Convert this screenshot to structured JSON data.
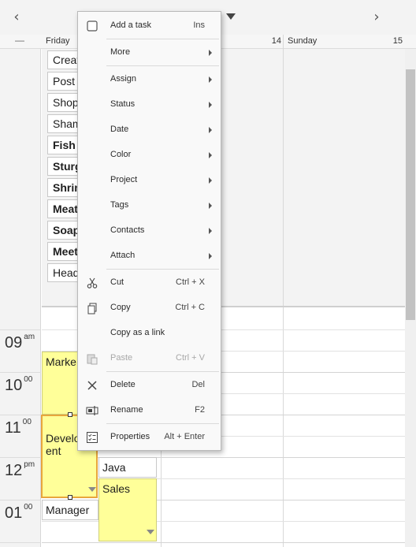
{
  "nav": {
    "prev_icon": "chevron-left-icon",
    "next_icon": "chevron-right-icon",
    "prev_glyph": "‹",
    "next_glyph": "›",
    "dropdown_icon": "caret-down-icon",
    "collapse_glyph": "—"
  },
  "days": [
    {
      "name": "Friday",
      "number": ""
    },
    {
      "name": "",
      "number": "14"
    },
    {
      "name": "Sunday",
      "number": "15"
    }
  ],
  "hours": [
    {
      "hour": "09",
      "suffix": "am"
    },
    {
      "hour": "10",
      "suffix": "00"
    },
    {
      "hour": "11",
      "suffix": "00"
    },
    {
      "hour": "12",
      "suffix": "pm"
    },
    {
      "hour": "01",
      "suffix": "00"
    }
  ],
  "tasks": [
    {
      "label": "Creat",
      "bold": false
    },
    {
      "label": "Post",
      "bold": false
    },
    {
      "label": "Shop",
      "bold": false
    },
    {
      "label": "Sham",
      "bold": false
    },
    {
      "label": "Fish",
      "bold": true
    },
    {
      "label": "Sturg",
      "bold": true
    },
    {
      "label": "Shrin",
      "bold": true
    },
    {
      "label": "Meat",
      "bold": true
    },
    {
      "label": "Soap",
      "bold": true
    },
    {
      "label": "Meet",
      "bold": true
    },
    {
      "label": "Head",
      "bold": false
    }
  ],
  "events": {
    "marketing": "Marke",
    "development": "Develo\nent",
    "java": "Java",
    "sales": "Sales",
    "manager": "Manager"
  },
  "context_menu": {
    "add_task": {
      "label": "Add a task",
      "shortcut": "Ins",
      "icon": "checkbox-icon"
    },
    "more": {
      "label": "More"
    },
    "assign": {
      "label": "Assign"
    },
    "status": {
      "label": "Status"
    },
    "date": {
      "label": "Date"
    },
    "color": {
      "label": "Color"
    },
    "project": {
      "label": "Project"
    },
    "tags": {
      "label": "Tags"
    },
    "contacts": {
      "label": "Contacts"
    },
    "attach": {
      "label": "Attach"
    },
    "cut": {
      "label": "Cut",
      "shortcut": "Ctrl + X",
      "icon": "scissors-icon"
    },
    "copy": {
      "label": "Copy",
      "shortcut": "Ctrl + C",
      "icon": "copy-icon"
    },
    "copy_link": {
      "label": "Copy as a link"
    },
    "paste": {
      "label": "Paste",
      "shortcut": "Ctrl + V",
      "icon": "paste-icon",
      "disabled": true
    },
    "delete": {
      "label": "Delete",
      "shortcut": "Del",
      "icon": "x-icon"
    },
    "rename": {
      "label": "Rename",
      "shortcut": "F2",
      "icon": "rename-icon"
    },
    "properties": {
      "label": "Properties",
      "shortcut": "Alt + Enter",
      "icon": "properties-icon"
    }
  },
  "colors": {
    "event_yellow": "#ffff99",
    "selection_orange": "#e8a63c",
    "menu_background": "#f9f9f9"
  }
}
